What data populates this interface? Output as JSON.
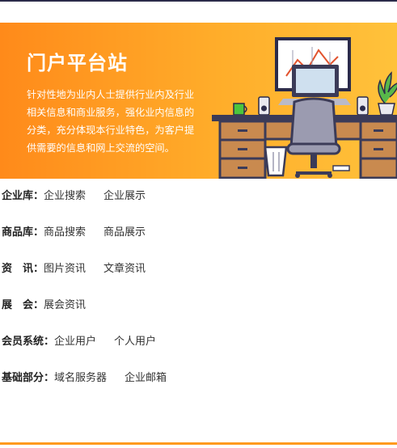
{
  "banner": {
    "title": "门户平台站",
    "description": "针对性地为业内人士提供行业内及行业相关信息和商业服务，强化业内信息的分类，充分体现本行业特色，为客户提供需要的信息和网上交流的空间。"
  },
  "menu": [
    {
      "label": "企业库：",
      "links": [
        "企业搜索",
        "企业展示"
      ]
    },
    {
      "label": "商品库：",
      "links": [
        "商品搜索",
        "商品展示"
      ]
    },
    {
      "label": "资　讯：",
      "links": [
        "图片资讯",
        "文章资讯"
      ]
    },
    {
      "label": "展　会：",
      "links": [
        "展会资讯"
      ]
    },
    {
      "label": "会员系统：",
      "links": [
        "企业用户",
        "个人用户"
      ]
    },
    {
      "label": "基础部分：",
      "links": [
        "域名服务器",
        "企业邮箱"
      ]
    }
  ],
  "colors": {
    "banner_gradient_start": "#ff8a1a",
    "banner_gradient_end": "#ffc23b",
    "accent_line": "#ff9a1e",
    "top_bar": "#2b2b4a"
  },
  "icons": [
    "office-desk-illustration",
    "whiteboard-chart-icon",
    "laptop-icon",
    "office-chair-icon",
    "trash-bin-icon",
    "mug-icon",
    "speaker-icon",
    "potted-plant-icon"
  ]
}
